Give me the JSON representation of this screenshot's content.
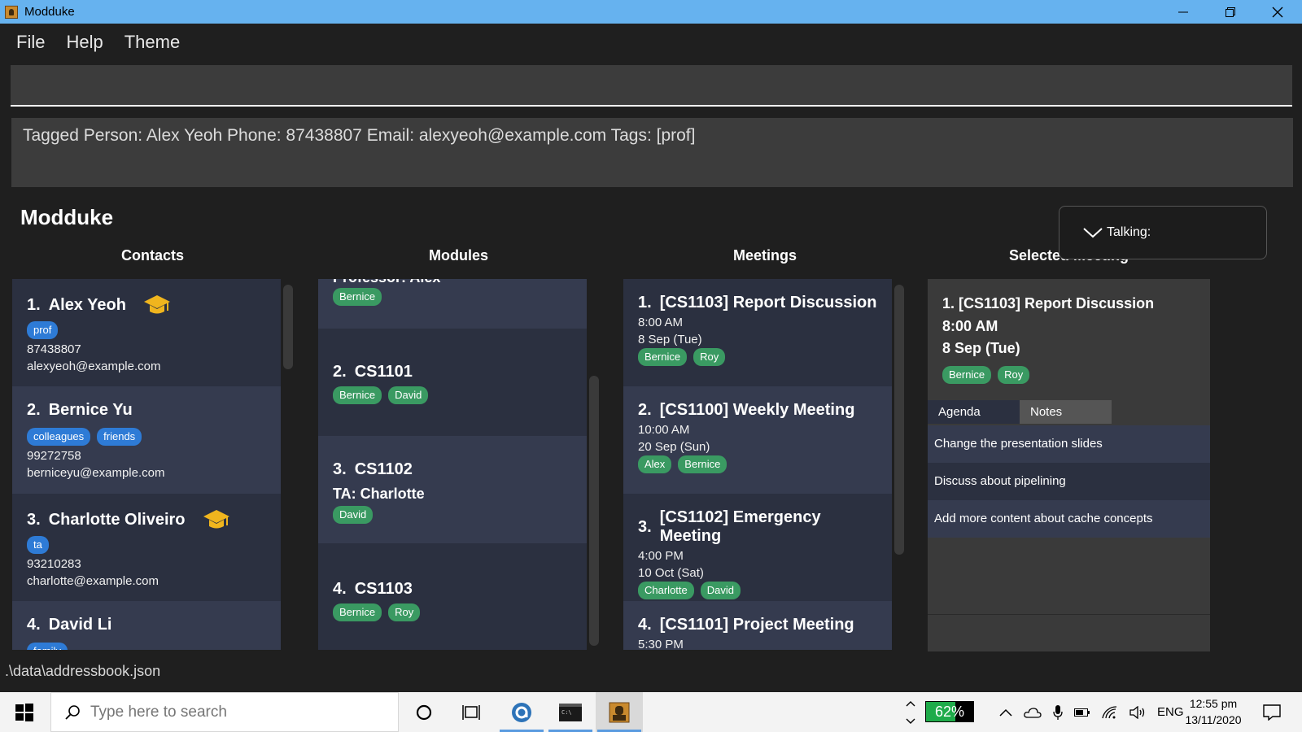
{
  "window": {
    "title": "Modduke"
  },
  "menu": {
    "items": [
      "File",
      "Help",
      "Theme"
    ]
  },
  "command": {
    "value": "",
    "placeholder": ""
  },
  "result": {
    "text": "Tagged Person: Alex Yeoh Phone: 87438807 Email: alexyeoh@example.com Tags: [prof]"
  },
  "app_heading": "Modduke",
  "columns": {
    "contacts": "Contacts",
    "modules": "Modules",
    "meetings": "Meetings",
    "selected": "Selected Meeting"
  },
  "contacts": [
    {
      "index": "1.",
      "name": "Alex Yeoh",
      "tags": [
        "prof"
      ],
      "phone": "87438807",
      "email": "alexyeoh@example.com",
      "icon": "graduation-cap-icon"
    },
    {
      "index": "2.",
      "name": "Bernice Yu",
      "tags": [
        "colleagues",
        "friends"
      ],
      "phone": "99272758",
      "email": "berniceyu@example.com"
    },
    {
      "index": "3.",
      "name": "Charlotte Oliveiro",
      "tags": [
        "ta"
      ],
      "phone": "93210283",
      "email": "charlotte@example.com",
      "icon": "graduation-cap-icon"
    },
    {
      "index": "4.",
      "name": "David Li",
      "tags": [
        "family"
      ]
    }
  ],
  "modules": [
    {
      "partial_line": "Professor: Alex",
      "tags": [
        "Bernice"
      ]
    },
    {
      "index": "2.",
      "code": "CS1101",
      "tags": [
        "Bernice",
        "David"
      ]
    },
    {
      "index": "3.",
      "code": "CS1102",
      "ta": "TA: Charlotte",
      "tags": [
        "David"
      ]
    },
    {
      "index": "4.",
      "code": "CS1103",
      "tags": [
        "Bernice",
        "Roy"
      ]
    }
  ],
  "meetings": [
    {
      "index": "1.",
      "title": "[CS1103] Report Discussion",
      "time": "8:00 AM",
      "date": "8 Sep (Tue)",
      "tags": [
        "Bernice",
        "Roy"
      ]
    },
    {
      "index": "2.",
      "title": "[CS1100] Weekly Meeting",
      "time": "10:00 AM",
      "date": "20 Sep (Sun)",
      "tags": [
        "Alex",
        "Bernice"
      ]
    },
    {
      "index": "3.",
      "title": "[CS1102] Emergency Meeting",
      "time": "4:00 PM",
      "date": "10 Oct (Sat)",
      "tags": [
        "Charlotte",
        "David"
      ]
    },
    {
      "index": "4.",
      "title": "[CS1101] Project Meeting",
      "time": "5:30 PM"
    }
  ],
  "selected_meeting": {
    "title": "1.  [CS1103] Report Discussion",
    "time": "8:00 AM",
    "date": "8 Sep (Tue)",
    "tags": [
      "Bernice",
      "Roy"
    ],
    "tabs": [
      "Agenda",
      "Notes"
    ],
    "agenda": [
      "Change the presentation slides",
      "Discuss about pipelining",
      "Add more content about cache concepts"
    ]
  },
  "talking_popup": {
    "label": "Talking:"
  },
  "status": {
    "path": ".\\data\\addressbook.json"
  },
  "taskbar": {
    "search_placeholder": "Type here to search",
    "battery": "62%",
    "language": "ENG",
    "time": "12:55 pm",
    "date": "13/11/2020"
  },
  "colors": {
    "tag_blue": "#2e7bd6",
    "tag_green": "#3a9a62",
    "card_dark": "#2b3040",
    "card_light": "#353b4f",
    "titlebar": "#66b2ef"
  }
}
